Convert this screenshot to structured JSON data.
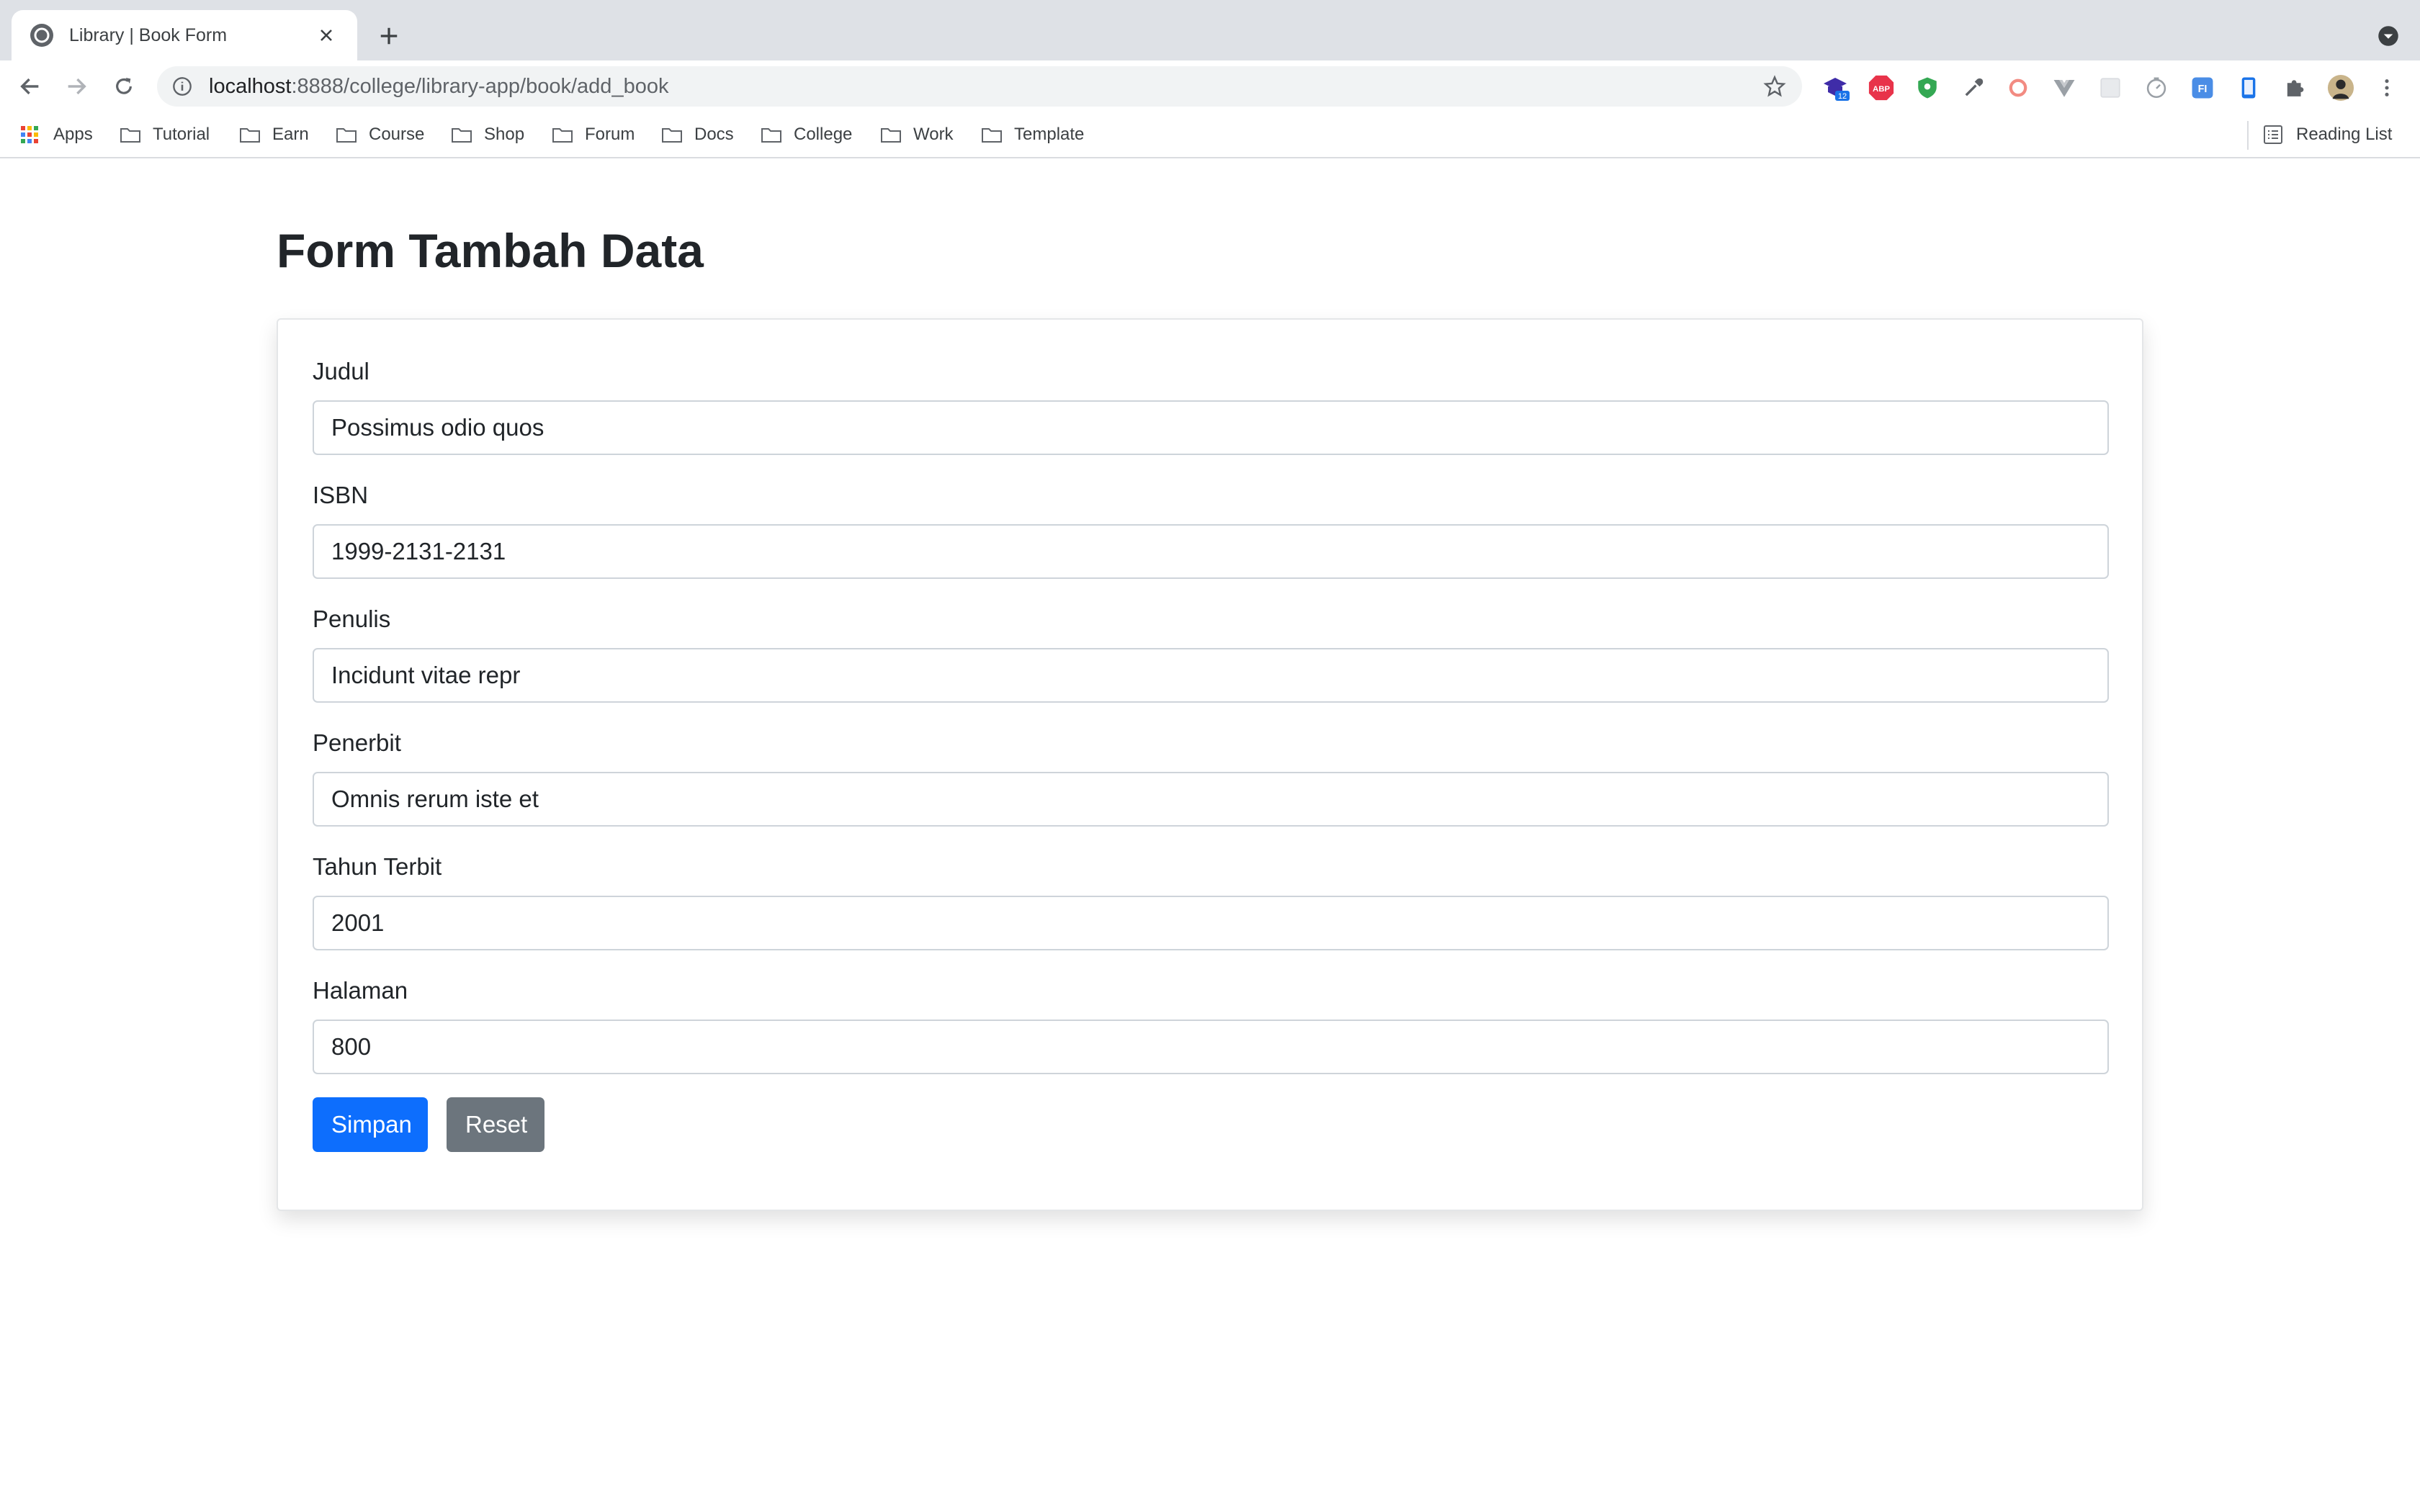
{
  "browser": {
    "tab_title": "Library | Book Form",
    "url_host": "localhost",
    "url_path": ":8888/college/library-app/book/add_book",
    "extension_badge": "12",
    "bookmarks": [
      {
        "label": "Apps",
        "icon": "apps-grid-icon"
      },
      {
        "label": "Tutorial",
        "icon": "folder-icon"
      },
      {
        "label": "Earn",
        "icon": "folder-icon"
      },
      {
        "label": "Course",
        "icon": "folder-icon"
      },
      {
        "label": "Shop",
        "icon": "folder-icon"
      },
      {
        "label": "Forum",
        "icon": "folder-icon"
      },
      {
        "label": "Docs",
        "icon": "folder-icon"
      },
      {
        "label": "College",
        "icon": "folder-icon"
      },
      {
        "label": "Work",
        "icon": "folder-icon"
      },
      {
        "label": "Template",
        "icon": "folder-icon"
      }
    ],
    "reading_list": "Reading List"
  },
  "page": {
    "title": "Form Tambah Data",
    "fields": [
      {
        "label": "Judul",
        "value": "Possimus odio quos"
      },
      {
        "label": "ISBN",
        "value": "1999-2131-2131"
      },
      {
        "label": "Penulis",
        "value": "Incidunt vitae repr"
      },
      {
        "label": "Penerbit",
        "value": "Omnis rerum iste et"
      },
      {
        "label": "Tahun Terbit",
        "value": "2001"
      },
      {
        "label": "Halaman",
        "value": "800"
      }
    ],
    "buttons": {
      "save": "Simpan",
      "reset": "Reset"
    }
  },
  "colors": {
    "primary": "#0d6efd",
    "secondary": "#6c757d",
    "text": "#212529"
  }
}
